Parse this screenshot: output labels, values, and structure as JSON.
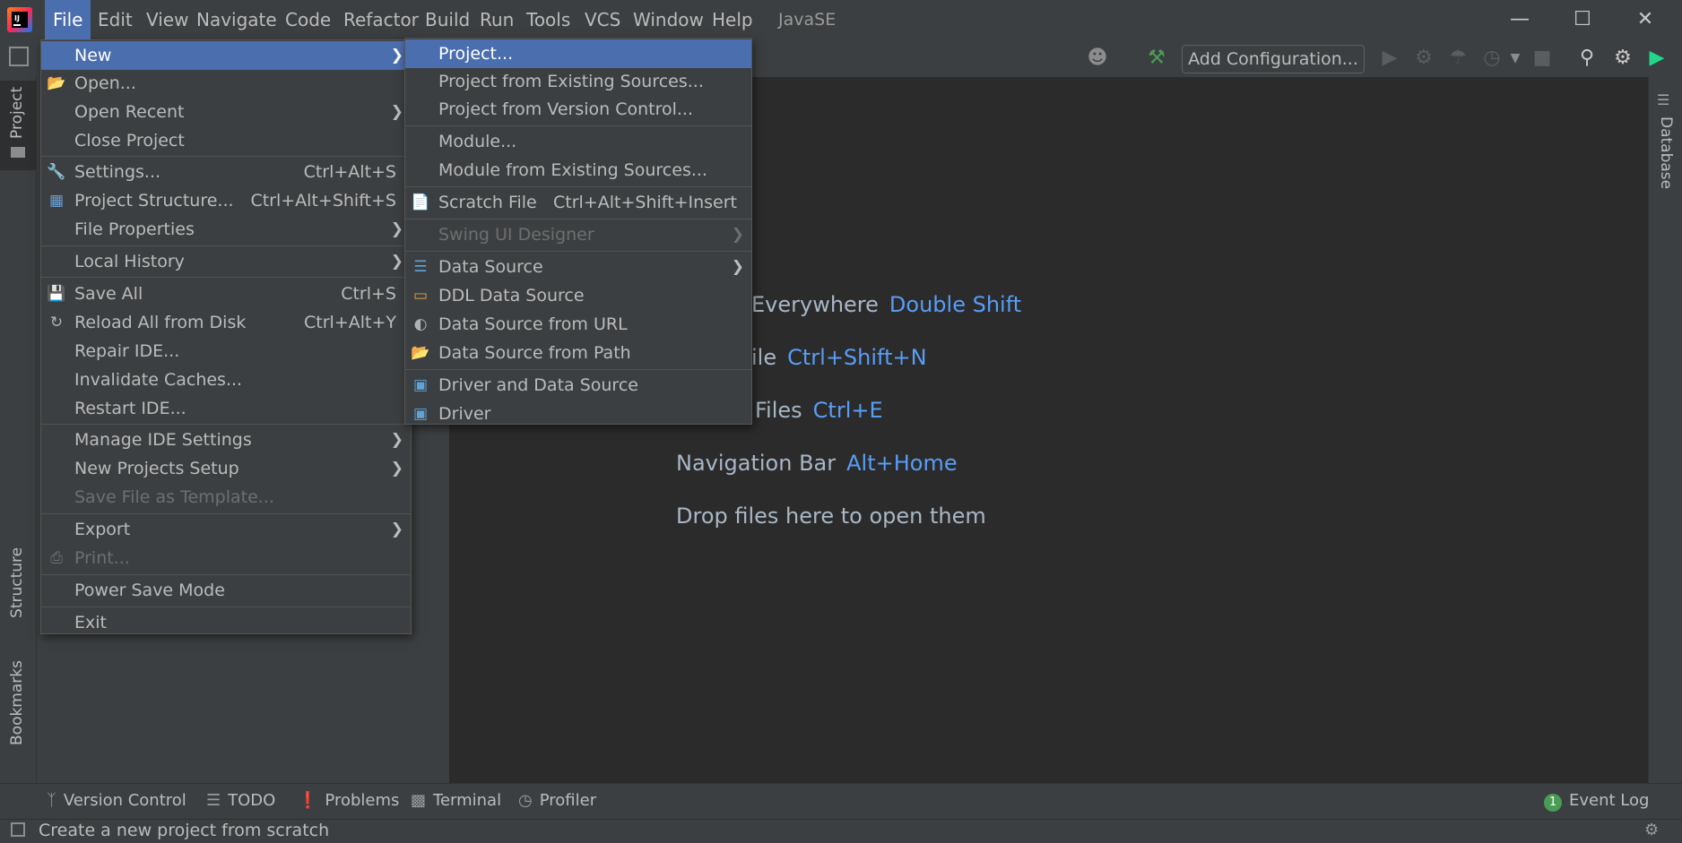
{
  "menubar": {
    "items": [
      "File",
      "Edit",
      "View",
      "Navigate",
      "Code",
      "Refactor",
      "Build",
      "Run",
      "Tools",
      "VCS",
      "Window",
      "Help"
    ],
    "window_title": "JavaSE"
  },
  "toolbar": {
    "add_configuration": "Add Configuration..."
  },
  "left_strip": {
    "project": "Project",
    "structure": "Structure",
    "bookmarks": "Bookmarks"
  },
  "right_strip": {
    "database": "Database"
  },
  "file_menu": {
    "items": [
      {
        "label": "New",
        "shortcut": "",
        "submenu": true,
        "disabled": false,
        "selected": true
      },
      {
        "label": "Open...",
        "shortcut": "",
        "submenu": false,
        "disabled": false
      },
      {
        "label": "Open Recent",
        "shortcut": "",
        "submenu": true,
        "disabled": false
      },
      {
        "label": "Close Project",
        "shortcut": "",
        "submenu": false,
        "disabled": false
      },
      {
        "label": "Settings...",
        "shortcut": "Ctrl+Alt+S",
        "submenu": false,
        "disabled": false
      },
      {
        "label": "Project Structure...",
        "shortcut": "Ctrl+Alt+Shift+S",
        "submenu": false,
        "disabled": false
      },
      {
        "label": "File Properties",
        "shortcut": "",
        "submenu": true,
        "disabled": false
      },
      {
        "label": "Local History",
        "shortcut": "",
        "submenu": true,
        "disabled": false
      },
      {
        "label": "Save All",
        "shortcut": "Ctrl+S",
        "submenu": false,
        "disabled": false
      },
      {
        "label": "Reload All from Disk",
        "shortcut": "Ctrl+Alt+Y",
        "submenu": false,
        "disabled": false
      },
      {
        "label": "Repair IDE...",
        "shortcut": "",
        "submenu": false,
        "disabled": false
      },
      {
        "label": "Invalidate Caches...",
        "shortcut": "",
        "submenu": false,
        "disabled": false
      },
      {
        "label": "Restart IDE...",
        "shortcut": "",
        "submenu": false,
        "disabled": false
      },
      {
        "label": "Manage IDE Settings",
        "shortcut": "",
        "submenu": true,
        "disabled": false
      },
      {
        "label": "New Projects Setup",
        "shortcut": "",
        "submenu": true,
        "disabled": false
      },
      {
        "label": "Save File as Template...",
        "shortcut": "",
        "submenu": false,
        "disabled": true
      },
      {
        "label": "Export",
        "shortcut": "",
        "submenu": true,
        "disabled": false
      },
      {
        "label": "Print...",
        "shortcut": "",
        "submenu": false,
        "disabled": true
      },
      {
        "label": "Power Save Mode",
        "shortcut": "",
        "submenu": false,
        "disabled": false
      },
      {
        "label": "Exit",
        "shortcut": "",
        "submenu": false,
        "disabled": false
      }
    ]
  },
  "new_submenu": {
    "items": [
      {
        "label": "Project...",
        "shortcut": "",
        "submenu": false,
        "disabled": false,
        "selected": true
      },
      {
        "label": "Project from Existing Sources...",
        "shortcut": "",
        "submenu": false,
        "disabled": false
      },
      {
        "label": "Project from Version Control...",
        "shortcut": "",
        "submenu": false,
        "disabled": false
      },
      {
        "label": "Module...",
        "shortcut": "",
        "submenu": false,
        "disabled": false
      },
      {
        "label": "Module from Existing Sources...",
        "shortcut": "",
        "submenu": false,
        "disabled": false
      },
      {
        "label": "Scratch File",
        "shortcut": "Ctrl+Alt+Shift+Insert",
        "submenu": false,
        "disabled": false
      },
      {
        "label": "Swing UI Designer",
        "shortcut": "",
        "submenu": true,
        "disabled": true
      },
      {
        "label": "Data Source",
        "shortcut": "",
        "submenu": true,
        "disabled": false
      },
      {
        "label": "DDL Data Source",
        "shortcut": "",
        "submenu": false,
        "disabled": false
      },
      {
        "label": "Data Source from URL",
        "shortcut": "",
        "submenu": false,
        "disabled": false
      },
      {
        "label": "Data Source from Path",
        "shortcut": "",
        "submenu": false,
        "disabled": false
      },
      {
        "label": "Driver and Data Source",
        "shortcut": "",
        "submenu": false,
        "disabled": false
      },
      {
        "label": "Driver",
        "shortcut": "",
        "submenu": false,
        "disabled": false
      }
    ]
  },
  "editor_hints": [
    {
      "label": "Everywhere",
      "key": "Double Shift"
    },
    {
      "label": "ile",
      "key": "Ctrl+Shift+N"
    },
    {
      "label": "Files",
      "key": "Ctrl+E"
    },
    {
      "label": "Navigation Bar",
      "key": "Alt+Home"
    },
    {
      "label": "Drop files here to open them",
      "key": ""
    }
  ],
  "bottom_bar": {
    "version_control": "Version Control",
    "todo": "TODO",
    "problems": "Problems",
    "terminal": "Terminal",
    "profiler": "Profiler",
    "event_log": "Event Log",
    "event_log_count": "1"
  },
  "status": {
    "text": "Create a new project from scratch"
  },
  "colors": {
    "accent": "#4b6eaf",
    "key_blue": "#589df6",
    "bg": "#2b2b2b",
    "panel": "#3c3f41"
  }
}
